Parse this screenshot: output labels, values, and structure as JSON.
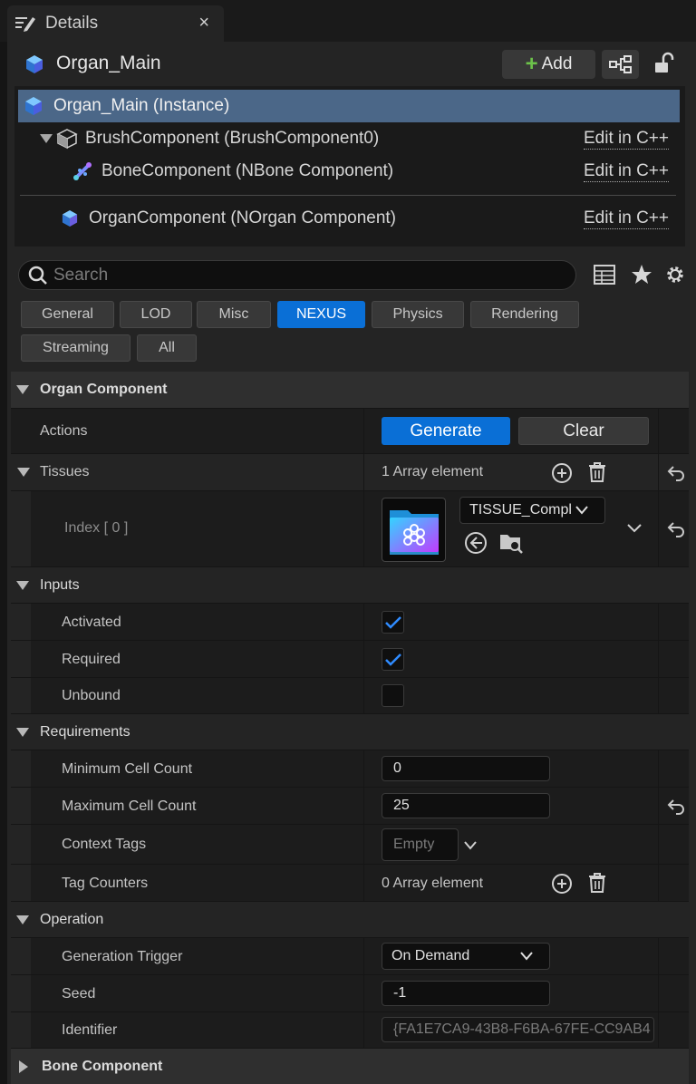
{
  "tab": {
    "title": "Details",
    "close_glyph": "×"
  },
  "header": {
    "title": "Organ_Main",
    "add_label": "Add",
    "add_glyph": "+"
  },
  "tree": [
    {
      "label": "Organ_Main (Instance)",
      "icon": "actor-cube-icon"
    },
    {
      "label": "BrushComponent (BrushComponent0)",
      "icon": "brush-cube-icon",
      "action": "Edit in C++"
    },
    {
      "label": "BoneComponent (NBone Component)",
      "icon": "bone-icon",
      "action": "Edit in C++"
    },
    {
      "label": "OrganComponent (NOrgan Component)",
      "icon": "organ-cube-icon",
      "action": "Edit in C++"
    }
  ],
  "search": {
    "placeholder": "Search",
    "value": ""
  },
  "categories": [
    "General",
    "LOD",
    "Misc",
    "NEXUS",
    "Physics",
    "Rendering",
    "Streaming",
    "All"
  ],
  "selected_category": "NEXUS",
  "organ": {
    "section_label": "Organ Component",
    "actions_label": "Actions",
    "generate_label": "Generate",
    "clear_label": "Clear",
    "tissues_label": "Tissues",
    "tissues_count": "1 Array element",
    "index_label": "Index [ 0 ]",
    "tissue_value": "TISSUE_Compl"
  },
  "inputs": {
    "section_label": "Inputs",
    "activated_label": "Activated",
    "activated": true,
    "required_label": "Required",
    "required": true,
    "unbound_label": "Unbound",
    "unbound": false
  },
  "requirements": {
    "section_label": "Requirements",
    "min_label": "Minimum Cell Count",
    "min_value": "0",
    "max_label": "Maximum Cell Count",
    "max_value": "25",
    "context_label": "Context Tags",
    "context_value": "Empty",
    "counters_label": "Tag Counters",
    "counters_count": "0 Array element"
  },
  "operation": {
    "section_label": "Operation",
    "trigger_label": "Generation Trigger",
    "trigger_value": "On Demand",
    "seed_label": "Seed",
    "seed_value": "-1",
    "identifier_label": "Identifier",
    "identifier_value": "{FA1E7CA9-43B8-F6BA-67FE-CC9AB4"
  },
  "bone": {
    "section_label": "Bone Component"
  },
  "colors": {
    "accent": "#0a6fd6",
    "selection": "#4b6788",
    "add_green": "#6cc24a",
    "panel": "#242424"
  }
}
